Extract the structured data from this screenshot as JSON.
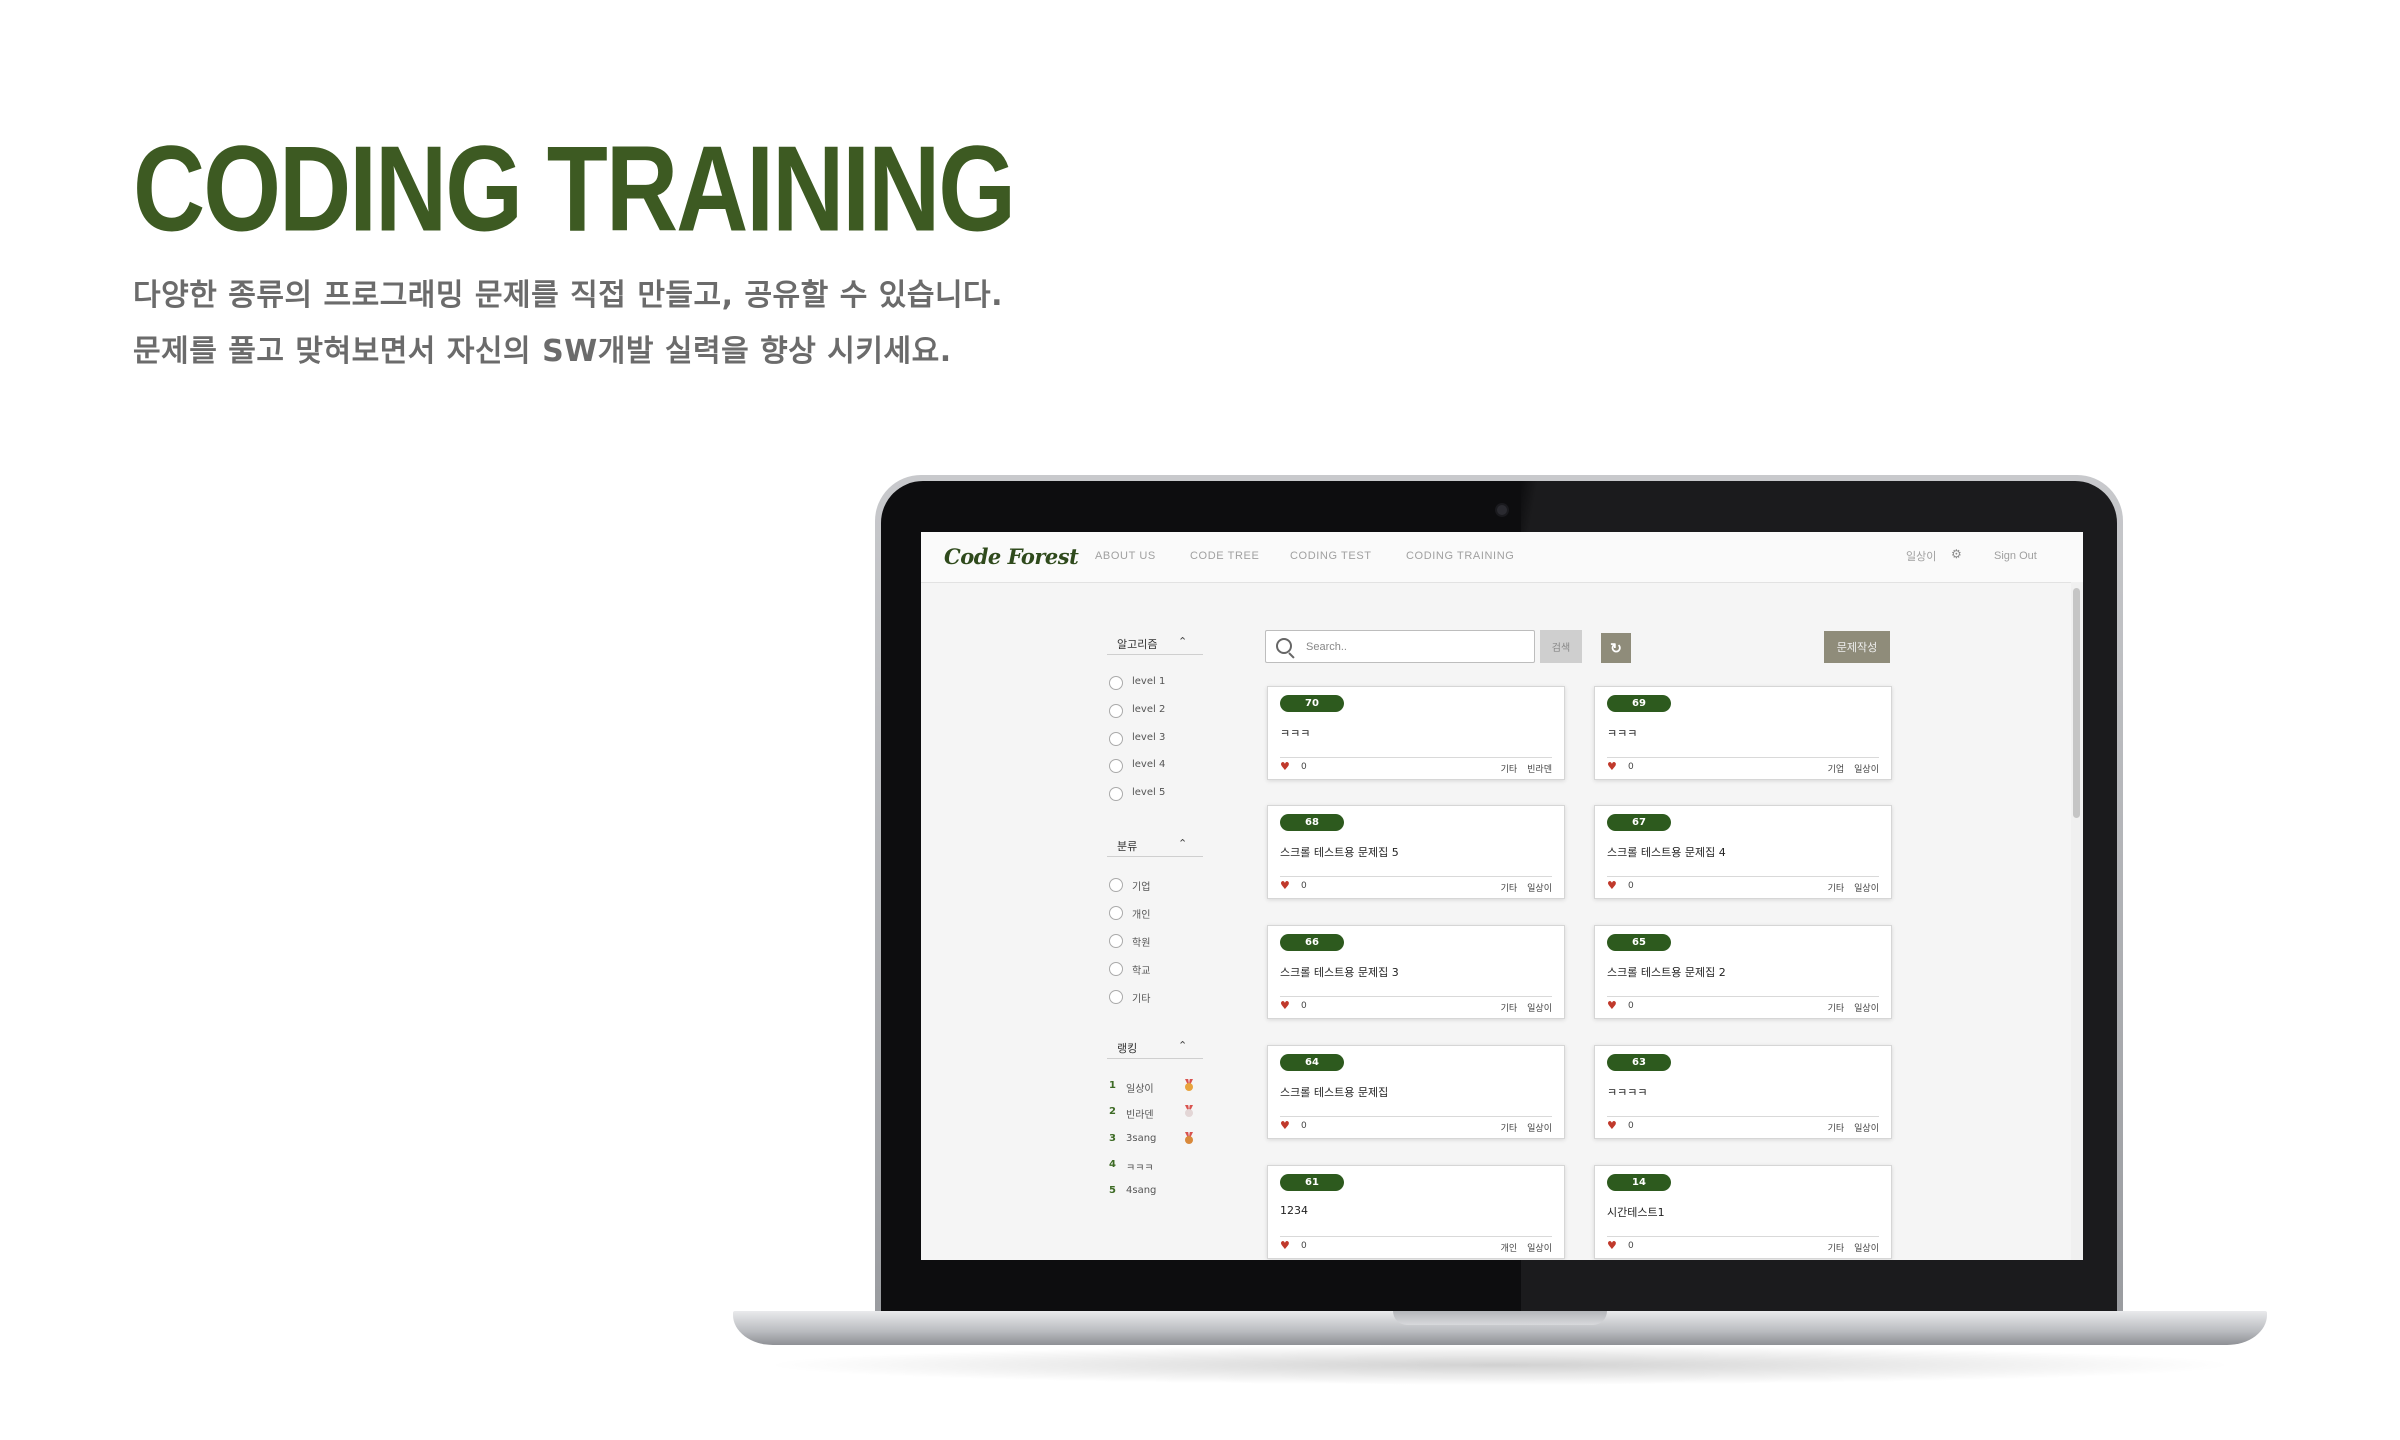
{
  "hero": {
    "title": "CODING TRAINING",
    "line1": "다양한 종류의 프로그래밍 문제를 직접 만들고, 공유할 수 있습니다.",
    "line2": "문제를 풀고 맞혀보면서 자신의 SW개발 실력을 향상 시키세요."
  },
  "navbar": {
    "brand": "Code Forest",
    "items": [
      "ABOUT US",
      "CODE TREE",
      "CODING TEST",
      "CODING TRAINING"
    ],
    "user": "일상이",
    "signout": "Sign Out"
  },
  "sidebar": {
    "algorithm": {
      "label": "알고리즘",
      "options": [
        "level 1",
        "level 2",
        "level 3",
        "level 4",
        "level 5"
      ]
    },
    "category": {
      "label": "분류",
      "options": [
        "기업",
        "개인",
        "학원",
        "학교",
        "기타"
      ]
    },
    "ranking": {
      "label": "랭킹",
      "items": [
        {
          "rank": "1",
          "name": "일상이",
          "medal": "gold"
        },
        {
          "rank": "2",
          "name": "빈라덴",
          "medal": "silver"
        },
        {
          "rank": "3",
          "name": "3sang",
          "medal": "bronze"
        },
        {
          "rank": "4",
          "name": "ㅋㅋㅋ",
          "medal": ""
        },
        {
          "rank": "5",
          "name": "4sang",
          "medal": ""
        }
      ]
    }
  },
  "toolbar": {
    "search_placeholder": "Search..",
    "search_button": "검색",
    "refresh_icon": "refresh-icon",
    "write_button": "문제작성"
  },
  "problems": [
    {
      "id": "70",
      "title": "ㅋㅋㅋ",
      "likes": "0",
      "category": "기타",
      "author": "빈라덴"
    },
    {
      "id": "69",
      "title": "ㅋㅋㅋ",
      "likes": "0",
      "category": "기업",
      "author": "일상이"
    },
    {
      "id": "68",
      "title": "스크롤 테스트용 문제집 5",
      "likes": "0",
      "category": "기타",
      "author": "일상이"
    },
    {
      "id": "67",
      "title": "스크롤 테스트용 문제집 4",
      "likes": "0",
      "category": "기타",
      "author": "일상이"
    },
    {
      "id": "66",
      "title": "스크롤 테스트용 문제집 3",
      "likes": "0",
      "category": "기타",
      "author": "일상이"
    },
    {
      "id": "65",
      "title": "스크롤 테스트용 문제집 2",
      "likes": "0",
      "category": "기타",
      "author": "일상이"
    },
    {
      "id": "64",
      "title": "스크롤 테스트용 문제집",
      "likes": "0",
      "category": "기타",
      "author": "일상이"
    },
    {
      "id": "63",
      "title": "ㅋㅋㅋㅋ",
      "likes": "0",
      "category": "기타",
      "author": "일상이"
    },
    {
      "id": "61",
      "title": "1234",
      "likes": "0",
      "category": "개인",
      "author": "일상이"
    },
    {
      "id": "14",
      "title": "시간테스트1",
      "likes": "0",
      "category": "기타",
      "author": "일상이"
    }
  ],
  "colors": {
    "brand_green": "#3d5a22",
    "badge_green": "#2d5a1e",
    "button_olive": "#8f8c7a",
    "heart_red": "#c0392b",
    "medal_gold": "#e8a33d",
    "medal_silver": "#e3d6d6",
    "medal_bronze": "#d9893b"
  }
}
